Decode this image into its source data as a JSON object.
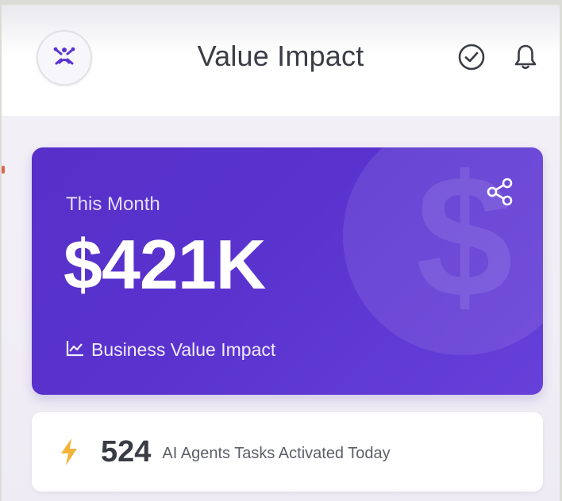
{
  "header": {
    "title": "Value Impact",
    "logo_icon": "network-people-icon",
    "actions": [
      {
        "name": "check-circle-icon"
      },
      {
        "name": "bell-icon"
      }
    ]
  },
  "hero": {
    "period_label": "This Month",
    "value": "$421K",
    "footer_label": "Business Value Impact",
    "footer_icon": "line-chart-icon",
    "background_icon": "dollar-icon",
    "share_icon": "share-icon",
    "colors": {
      "gradient_start": "#5630c8",
      "gradient_end": "#6640d9"
    }
  },
  "tasks": {
    "count": "524",
    "label": "AI Agents Tasks Activated Today",
    "icon": "lightning-bolt-icon",
    "icon_color": "#f2b33a"
  },
  "brand": {
    "accent": "#5a33cf"
  }
}
